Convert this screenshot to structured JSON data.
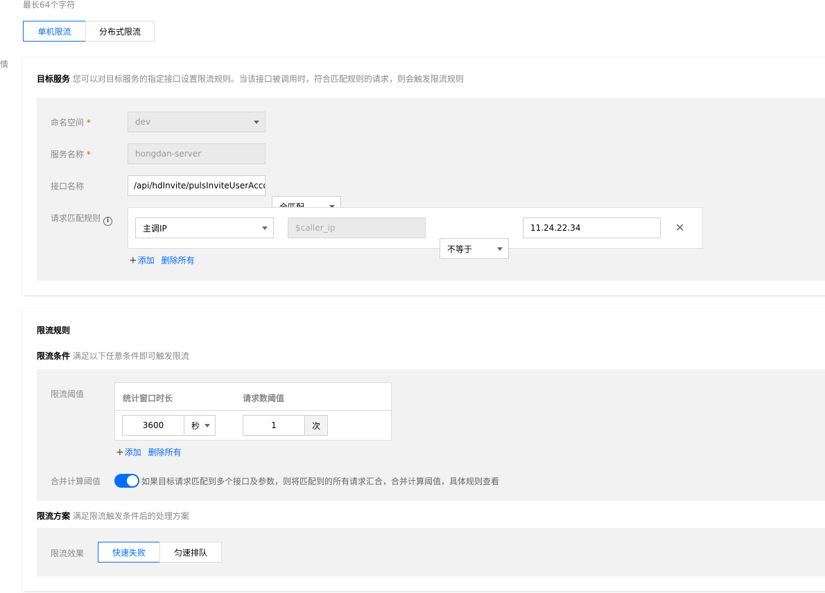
{
  "top": {
    "hint": "最长64个字符",
    "left_stub": "情",
    "mode_tabs": [
      {
        "label": "单机限流",
        "active": true
      },
      {
        "label": "分布式限流",
        "active": false
      }
    ]
  },
  "target_service": {
    "title": "目标服务",
    "tip": "您可以对目标服务的指定接口设置限流规则。当该接口被调用时，符合匹配规则的请求，则会触发限流规则",
    "namespace": {
      "label": "命名空间",
      "required_mark": "*",
      "value": "dev"
    },
    "service_name": {
      "label": "服务名称",
      "required_mark": "*",
      "value": "hongdan-server"
    },
    "api_name": {
      "label": "接口名称",
      "value": "/api/hdInvite/pulsInviteUserAccou",
      "match_mode": "全匹配"
    },
    "match_rules": {
      "label": "请求匹配规则",
      "rows": [
        {
          "source": "主调IP",
          "key": "$caller_ip",
          "operator": "不等于",
          "value": "11.24.22.34"
        }
      ],
      "add_label": "添加",
      "delete_all_label": "删除所有"
    }
  },
  "rate_limit": {
    "title": "限流规则",
    "conditions": {
      "title": "限流条件",
      "tip": "满足以下任意条件即可触发限流",
      "threshold_label": "限流阈值",
      "columns": [
        "统计窗口时长",
        "请求数阈值"
      ],
      "rows": [
        {
          "window": "3600",
          "unit": "秒",
          "count": "1",
          "count_unit": "次"
        }
      ],
      "add_label": "添加",
      "delete_all_label": "删除所有",
      "merge": {
        "label": "合并计算阈值",
        "enabled": true,
        "desc": "如果目标请求匹配到多个接口及参数，则将匹配到的所有请求汇合，合并计算阈值，具体规则查看"
      }
    },
    "plan": {
      "title": "限流方案",
      "tip": "满足限流触发条件后的处理方案",
      "effect_label": "限流效果",
      "options": [
        {
          "label": "快速失败",
          "active": true
        },
        {
          "label": "匀速排队",
          "active": false
        }
      ]
    }
  },
  "colors": {
    "accent": "#006eff",
    "required": "#e54545",
    "panel": "#f2f2f2"
  }
}
